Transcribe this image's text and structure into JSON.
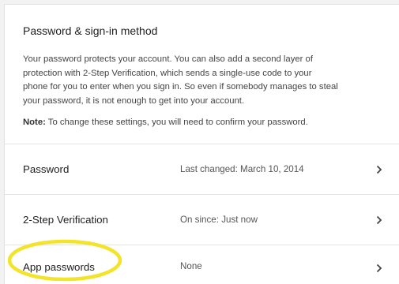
{
  "section": {
    "title": "Password & sign-in method",
    "description": "Your password protects your account. You can also add a second layer of protection with 2-Step Verification, which sends a single-use code to your phone for you to enter when you sign in. So even if somebody manages to steal your password, it is not enough to get into your account.",
    "note_label": "Note:",
    "note_text": " To change these settings, you will need to confirm your password."
  },
  "rows": [
    {
      "label": "Password",
      "value": "Last changed: March 10, 2014",
      "icon": "chevron-right-icon"
    },
    {
      "label": "2-Step Verification",
      "value": "On since: Just now",
      "icon": "chevron-right-icon"
    },
    {
      "label": "App passwords",
      "value": "None",
      "icon": "chevron-right-icon"
    }
  ],
  "colors": {
    "highlight": "#f3e32a",
    "text_primary": "#212121",
    "text_secondary": "#555555",
    "divider": "#e4e4e4"
  }
}
